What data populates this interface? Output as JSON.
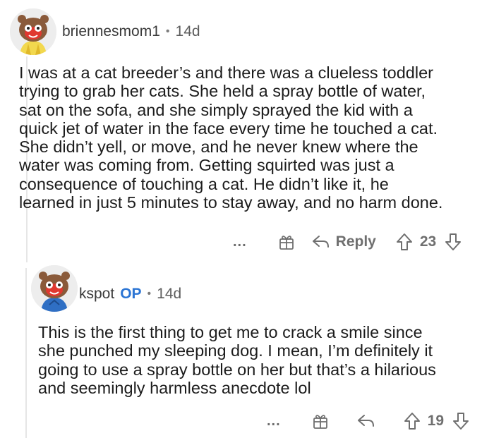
{
  "comments": [
    {
      "username": "briennesmom1",
      "time": "14d",
      "body_lines": [
        "I was at a cat breeder’s and there was a clueless toddler",
        "trying to grab her cats.  She held a spray bottle of water,",
        "sat on the sofa, and she simply sprayed the kid with a",
        "quick jet of water in  the face every time he touched a cat.",
        "She didn’t yell, or move, and he never knew where the",
        "water was coming from.  Getting squirted was just a",
        "consequence of touching a cat.  He didn’t like it, he",
        "learned in just 5 minutes to stay away, and no harm done."
      ],
      "more": "...",
      "reply_label": "Reply",
      "votes": "23"
    },
    {
      "username": "kspot",
      "op_badge": "OP",
      "time": "14d",
      "body_lines": [
        "This is the first thing to get me to crack a smile since",
        "she punched my sleeping dog.  I mean, I’m definitely it",
        "going to use a spray bottle on her but that’s a hilarious",
        "and seemingly harmless anecdote lol"
      ],
      "more": "...",
      "votes": "19"
    }
  ],
  "meta_separator": "•"
}
